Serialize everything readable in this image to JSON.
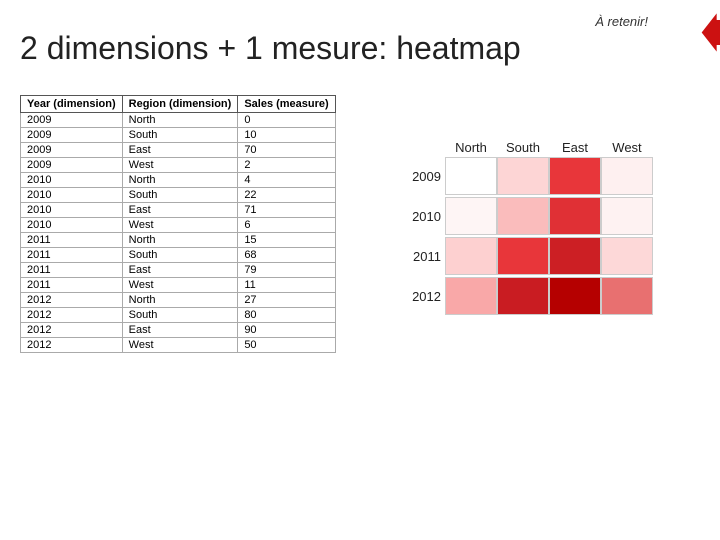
{
  "header": {
    "title": "2 dimensions + 1 mesure: heatmap",
    "a_retenir": "À retenir!"
  },
  "table": {
    "columns": [
      "Year (dimension)",
      "Region (dimension)",
      "Sales (measure)"
    ],
    "rows": [
      [
        "2009",
        "North",
        "0"
      ],
      [
        "2009",
        "South",
        "10"
      ],
      [
        "2009",
        "East",
        "70"
      ],
      [
        "2009",
        "West",
        "2"
      ],
      [
        "2010",
        "North",
        "4"
      ],
      [
        "2010",
        "South",
        "22"
      ],
      [
        "2010",
        "East",
        "71"
      ],
      [
        "2010",
        "West",
        "6"
      ],
      [
        "2011",
        "North",
        "15"
      ],
      [
        "2011",
        "South",
        "68"
      ],
      [
        "2011",
        "East",
        "79"
      ],
      [
        "2011",
        "West",
        "11"
      ],
      [
        "2012",
        "North",
        "27"
      ],
      [
        "2012",
        "South",
        "80"
      ],
      [
        "2012",
        "East",
        "90"
      ],
      [
        "2012",
        "West",
        "50"
      ]
    ]
  },
  "heatmap": {
    "col_labels": [
      "North",
      "South",
      "East",
      "West"
    ],
    "rows": [
      {
        "year": "2009",
        "cells": [
          {
            "value": 0,
            "color": "#ffffff"
          },
          {
            "value": 10,
            "color": "#fdd5d5"
          },
          {
            "value": 70,
            "color": "#e8363a"
          },
          {
            "value": 2,
            "color": "#fef0f0"
          }
        ]
      },
      {
        "year": "2010",
        "cells": [
          {
            "value": 4,
            "color": "#fef5f5"
          },
          {
            "value": 22,
            "color": "#fabcbc"
          },
          {
            "value": 71,
            "color": "#e03035"
          },
          {
            "value": 6,
            "color": "#fef2f2"
          }
        ]
      },
      {
        "year": "2011",
        "cells": [
          {
            "value": 15,
            "color": "#fdd0d0"
          },
          {
            "value": 68,
            "color": "#e8363a"
          },
          {
            "value": 79,
            "color": "#cc1f24"
          },
          {
            "value": 11,
            "color": "#fdd8d8"
          }
        ]
      },
      {
        "year": "2012",
        "cells": [
          {
            "value": 27,
            "color": "#f9a8a8"
          },
          {
            "value": 80,
            "color": "#c91c22"
          },
          {
            "value": 90,
            "color": "#b50000"
          },
          {
            "value": 50,
            "color": "#e87070"
          }
        ]
      }
    ]
  }
}
